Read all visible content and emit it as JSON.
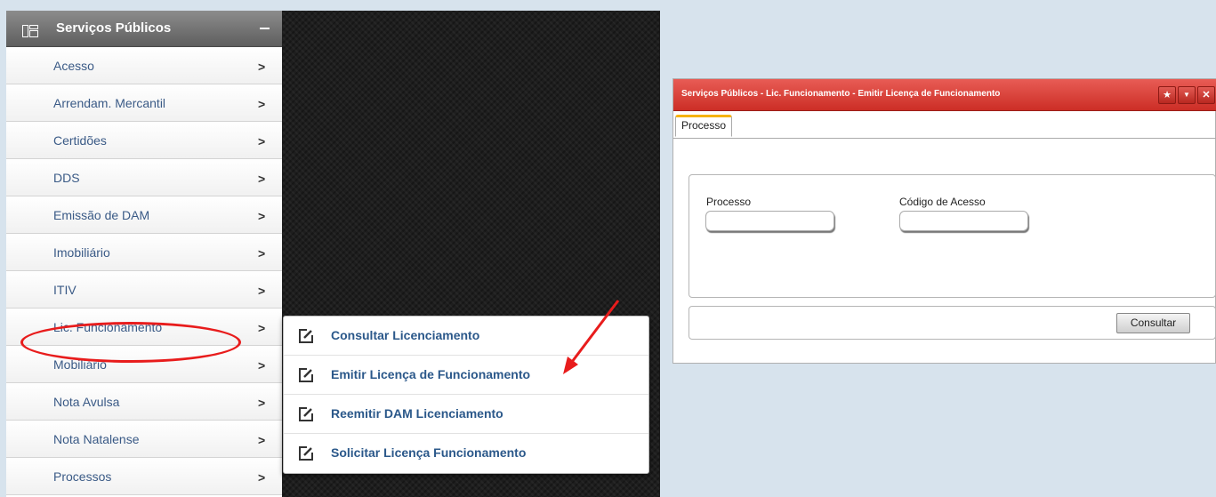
{
  "sidebar": {
    "title": "Serviços Públicos",
    "items": [
      {
        "label": "Acesso"
      },
      {
        "label": "Arrendam. Mercantil"
      },
      {
        "label": "Certidões"
      },
      {
        "label": "DDS"
      },
      {
        "label": "Emissão de DAM"
      },
      {
        "label": "Imobiliário"
      },
      {
        "label": "ITIV"
      },
      {
        "label": "Lic. Funcionamento"
      },
      {
        "label": "Mobiliário"
      },
      {
        "label": "Nota Avulsa"
      },
      {
        "label": "Nota Natalense"
      },
      {
        "label": "Processos"
      }
    ],
    "highlighted_item": "Lic. Funcionamento"
  },
  "submenu": {
    "items": [
      {
        "label": "Consultar Licenciamento"
      },
      {
        "label": "Emitir Licença de Funcionamento"
      },
      {
        "label": "Reemitir DAM Licenciamento"
      },
      {
        "label": "Solicitar Licença Funcionamento"
      }
    ]
  },
  "dialog": {
    "title": "Serviços Públicos - Lic. Funcionamento - Emitir Licença de Funcionamento",
    "buttons": [
      "star-icon",
      "chevron-down-icon",
      "close-icon"
    ],
    "tab": "Processo",
    "fields": [
      {
        "label": "Processo",
        "value": ""
      },
      {
        "label": "Código de Acesso",
        "value": ""
      }
    ],
    "submit_label": "Consultar"
  },
  "colors": {
    "titlebar": "#d9403a",
    "annotation": "#e81c1c",
    "link": "#3a5a86",
    "tab_accent": "#f6b30e"
  }
}
